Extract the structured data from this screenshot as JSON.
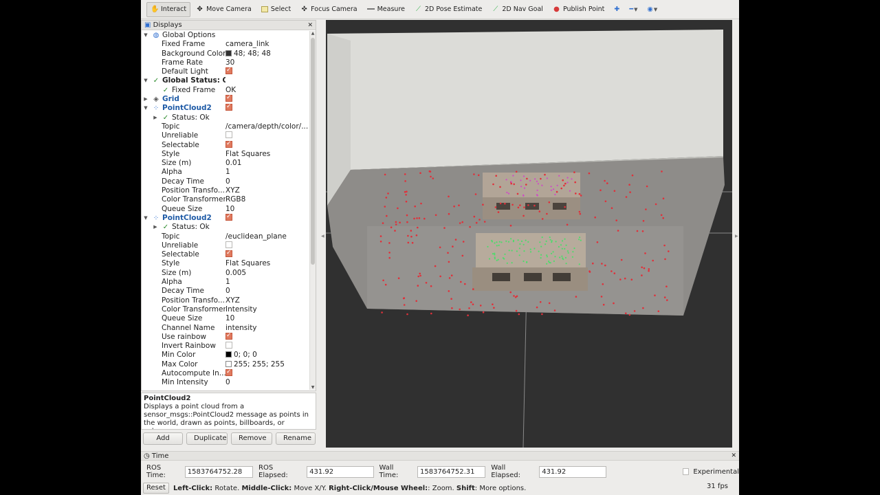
{
  "toolbar": {
    "tools": [
      {
        "label": "Interact",
        "icon": "hand-icon"
      },
      {
        "label": "Move Camera",
        "icon": "move-icon"
      },
      {
        "label": "Select",
        "icon": "select-box-icon"
      },
      {
        "label": "Focus Camera",
        "icon": "focus-icon"
      },
      {
        "label": "Measure",
        "icon": "ruler-icon"
      },
      {
        "label": "2D Pose Estimate",
        "icon": "green-arrow-icon"
      },
      {
        "label": "2D Nav Goal",
        "icon": "green-arrow-icon"
      },
      {
        "label": "Publish Point",
        "icon": "pin-icon"
      }
    ]
  },
  "displays": {
    "title": "Displays",
    "rows": [
      {
        "depth": 0,
        "arrow": "▼",
        "icon": "globe-icon",
        "label": "Global Options",
        "style": ""
      },
      {
        "depth": 1,
        "label": "Fixed Frame",
        "value": "camera_link"
      },
      {
        "depth": 1,
        "label": "Background Color",
        "swatch": "#303030",
        "value": "48; 48; 48"
      },
      {
        "depth": 1,
        "label": "Frame Rate",
        "value": "30"
      },
      {
        "depth": 1,
        "label": "Default Light",
        "checkbox": true
      },
      {
        "depth": 0,
        "arrow": "▼",
        "icon": "check-icon",
        "label": "Global Status: Ok",
        "style": "bold"
      },
      {
        "depth": 1,
        "icon": "check-icon",
        "label": "Fixed Frame",
        "value": "OK"
      },
      {
        "depth": 0,
        "arrow": "▶",
        "icon": "grid-icon",
        "label": "Grid",
        "style": "blue",
        "checkbox": true
      },
      {
        "depth": 0,
        "arrow": "▼",
        "icon": "pointcloud-icon",
        "label": "PointCloud2",
        "style": "blue",
        "checkbox": true
      },
      {
        "depth": 1,
        "arrow": "▶",
        "icon": "check-icon",
        "label": "Status: Ok",
        "style": ""
      },
      {
        "depth": 1,
        "label": "Topic",
        "value": "/camera/depth/color/..."
      },
      {
        "depth": 1,
        "label": "Unreliable",
        "checkbox": false
      },
      {
        "depth": 1,
        "label": "Selectable",
        "checkbox": true
      },
      {
        "depth": 1,
        "label": "Style",
        "value": "Flat Squares"
      },
      {
        "depth": 1,
        "label": "Size (m)",
        "value": "0.01"
      },
      {
        "depth": 1,
        "label": "Alpha",
        "value": "1"
      },
      {
        "depth": 1,
        "label": "Decay Time",
        "value": "0"
      },
      {
        "depth": 1,
        "label": "Position Transfo...",
        "value": "XYZ"
      },
      {
        "depth": 1,
        "label": "Color Transformer",
        "value": "RGB8"
      },
      {
        "depth": 1,
        "label": "Queue Size",
        "value": "10"
      },
      {
        "depth": 0,
        "arrow": "▼",
        "icon": "pointcloud-icon",
        "label": "PointCloud2",
        "style": "blue",
        "checkbox": true
      },
      {
        "depth": 1,
        "arrow": "▶",
        "icon": "check-icon",
        "label": "Status: Ok",
        "style": ""
      },
      {
        "depth": 1,
        "label": "Topic",
        "value": "/euclidean_plane"
      },
      {
        "depth": 1,
        "label": "Unreliable",
        "checkbox": false
      },
      {
        "depth": 1,
        "label": "Selectable",
        "checkbox": true
      },
      {
        "depth": 1,
        "label": "Style",
        "value": "Flat Squares"
      },
      {
        "depth": 1,
        "label": "Size (m)",
        "value": "0.005"
      },
      {
        "depth": 1,
        "label": "Alpha",
        "value": "1"
      },
      {
        "depth": 1,
        "label": "Decay Time",
        "value": "0"
      },
      {
        "depth": 1,
        "label": "Position Transfo...",
        "value": "XYZ"
      },
      {
        "depth": 1,
        "label": "Color Transformer",
        "value": "Intensity"
      },
      {
        "depth": 1,
        "label": "Queue Size",
        "value": "10"
      },
      {
        "depth": 1,
        "label": "Channel Name",
        "value": "intensity"
      },
      {
        "depth": 1,
        "label": "Use rainbow",
        "checkbox": true
      },
      {
        "depth": 1,
        "label": "Invert Rainbow",
        "checkbox": false
      },
      {
        "depth": 1,
        "label": "Min Color",
        "swatch": "#000000",
        "value": "0; 0; 0"
      },
      {
        "depth": 1,
        "label": "Max Color",
        "swatch": "#ffffff",
        "value": "255; 255; 255"
      },
      {
        "depth": 1,
        "label": "Autocompute In...",
        "checkbox": true
      },
      {
        "depth": 1,
        "label": "Min Intensity",
        "value": "0"
      }
    ]
  },
  "description": {
    "title": "PointCloud2",
    "text": "Displays a point cloud from a sensor_msgs::PointCloud2 message as points in the world, drawn as points, billboards, or cubes."
  },
  "buttons": {
    "add": "Add",
    "duplicate": "Duplicate",
    "remove": "Remove",
    "rename": "Rename"
  },
  "time": {
    "title": "Time",
    "ros_time_label": "ROS Time:",
    "ros_time": "1583764752.28",
    "ros_elapsed_label": "ROS Elapsed:",
    "ros_elapsed": "431.92",
    "wall_time_label": "Wall Time:",
    "wall_time": "1583764752.31",
    "wall_elapsed_label": "Wall Elapsed:",
    "wall_elapsed": "431.92",
    "experimental_label": "Experimental"
  },
  "status": {
    "reset": "Reset",
    "hint_parts": [
      {
        "b": "Left-Click:",
        "t": " Rotate. "
      },
      {
        "b": "Middle-Click:",
        "t": " Move X/Y. "
      },
      {
        "b": "Right-Click/Mouse Wheel:",
        "t": ": Zoom. "
      },
      {
        "b": "Shift",
        "t": ": More options."
      }
    ],
    "fps": "31 fps"
  },
  "colors": {
    "accent_checkbox": "#e07a5f",
    "display_blue": "#1e5aa6",
    "viewport_bg": "#303030"
  }
}
